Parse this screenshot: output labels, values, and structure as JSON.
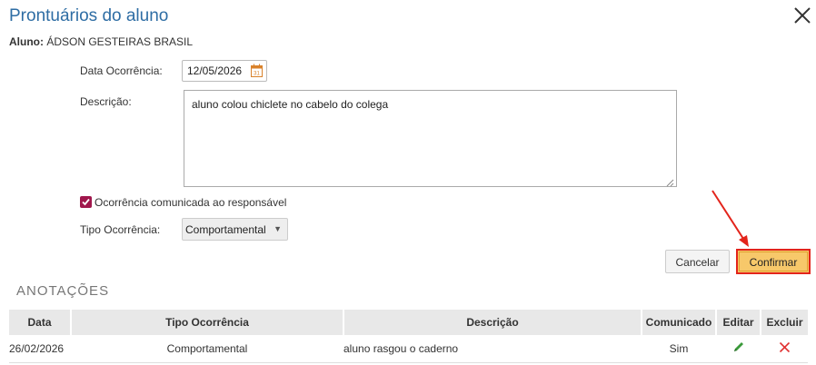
{
  "dialog": {
    "title": "Prontuários do aluno",
    "student_label": "Aluno:",
    "student_name": "ÁDSON GESTEIRAS BRASIL"
  },
  "form": {
    "date_label": "Data Ocorrência:",
    "date_value": "12/05/2026",
    "description_label": "Descrição:",
    "description_value": "aluno colou chiclete no cabelo do colega",
    "communicated_label": "Ocorrência comunicada ao responsável",
    "communicated_checked": true,
    "type_label": "Tipo Ocorrência:",
    "type_value": "Comportamental"
  },
  "actions": {
    "cancel_label": "Cancelar",
    "confirm_label": "Confirmar"
  },
  "annotations": {
    "section_title": "ANOTAÇÕES",
    "columns": {
      "date": "Data",
      "type": "Tipo Ocorrência",
      "description": "Descrição",
      "communicated": "Comunicado",
      "edit": "Editar",
      "delete": "Excluir"
    },
    "rows": [
      {
        "date": "26/02/2026",
        "type": "Comportamental",
        "description": "aluno rasgou o caderno",
        "communicated": "Sim"
      }
    ]
  },
  "colors": {
    "title": "#2e6da4",
    "checkbox": "#a0174c",
    "confirm_bg": "#f7c86a",
    "highlight": "#e3241b",
    "edit_icon": "#3a9a3a",
    "delete_icon": "#e03030"
  },
  "icons": {
    "close": "close-icon",
    "calendar": "calendar-icon",
    "edit": "pencil-icon",
    "delete": "x-icon"
  }
}
